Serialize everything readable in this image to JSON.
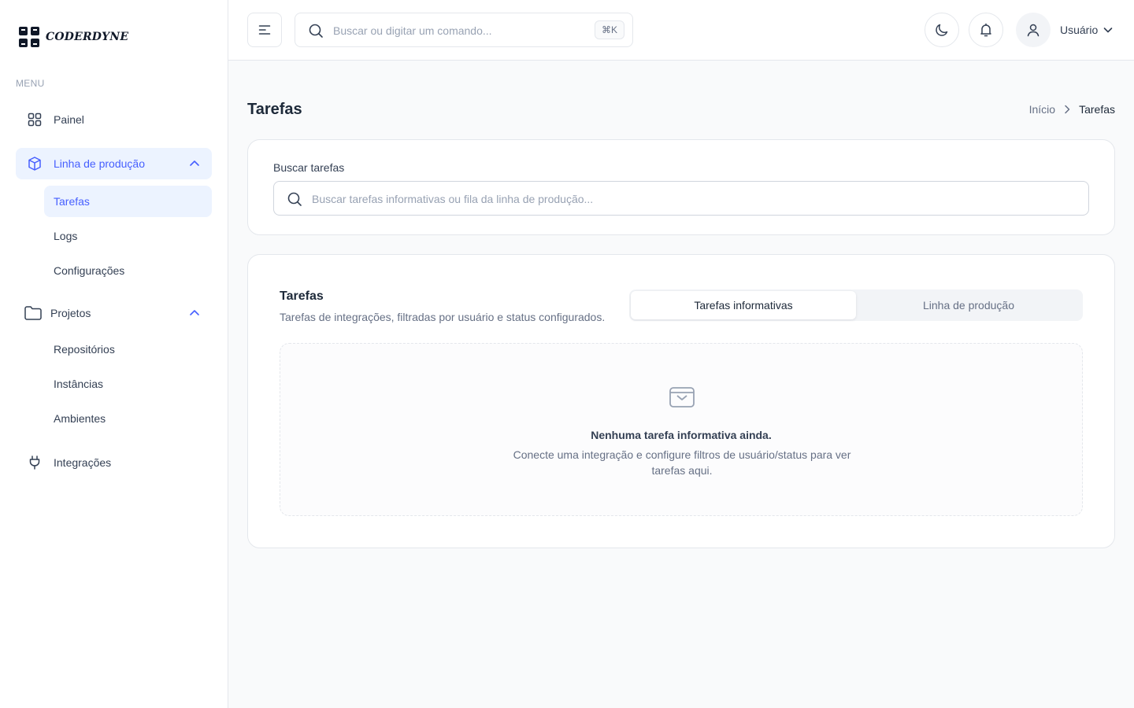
{
  "brand": {
    "name": "CODERDYNE"
  },
  "sidebar": {
    "menu_label": "MENU",
    "items": {
      "painel": {
        "label": "Painel",
        "icon": "grid-icon"
      },
      "linha": {
        "label": "Linha de produção",
        "icon": "box-icon",
        "expanded": true,
        "children": {
          "tarefas": "Tarefas",
          "logs": "Logs",
          "config": "Configurações"
        }
      },
      "projetos": {
        "label": "Projetos",
        "icon": "folder-icon",
        "expanded": true,
        "children": {
          "repos": "Repositórios",
          "instancias": "Instâncias",
          "ambientes": "Ambientes"
        }
      },
      "integracoes": {
        "label": "Integrações",
        "icon": "plug-icon"
      }
    }
  },
  "header": {
    "search_placeholder": "Buscar ou digitar um comando...",
    "shortcut": "⌘K",
    "user_name": "Usuário"
  },
  "page": {
    "title": "Tarefas",
    "breadcrumb": {
      "home": "Início",
      "current": "Tarefas"
    }
  },
  "search": {
    "label": "Buscar tarefas",
    "placeholder": "Buscar tarefas informativas ou fila da linha de produção..."
  },
  "tasks": {
    "title": "Tarefas",
    "description": "Tarefas de integrações, filtradas por usuário e status configurados.",
    "tabs": {
      "informativas": "Tarefas informativas",
      "linha": "Linha de produção"
    },
    "active_tab": "informativas",
    "empty": {
      "title": "Nenhuma tarefa informativa ainda.",
      "description": "Conecte uma integração e configure filtros de usuário/status para ver tarefas aqui."
    }
  },
  "colors": {
    "accent": "#465fff",
    "accent_bg": "#ecf3ff"
  }
}
